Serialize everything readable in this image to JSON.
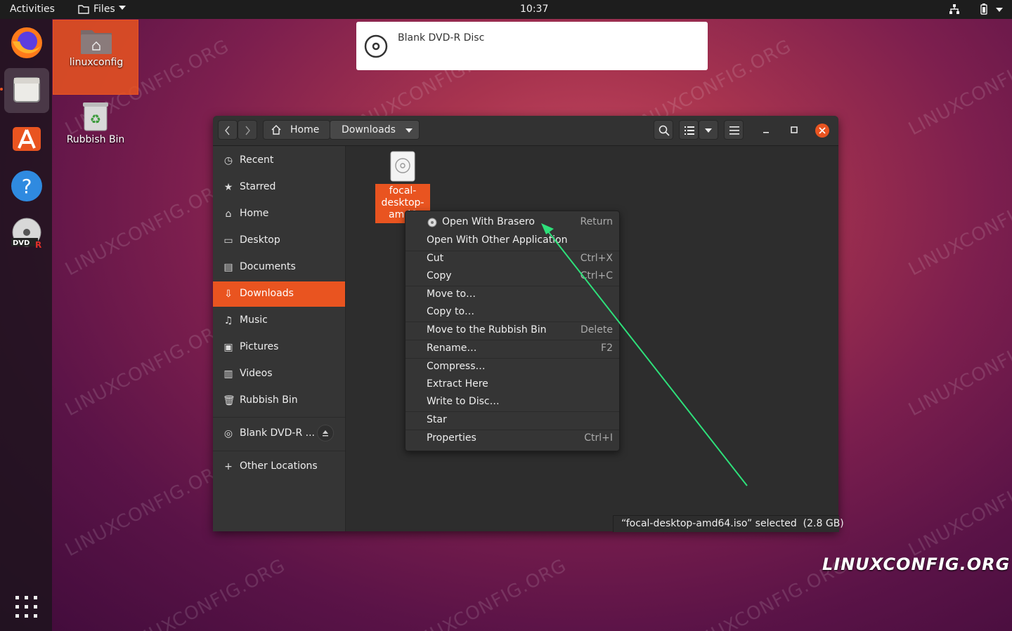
{
  "topbar": {
    "activities": "Activities",
    "app_menu": "Files",
    "clock": "10:37"
  },
  "desktop": {
    "home_folder": "linuxconfig",
    "trash": "Rubbish Bin"
  },
  "notification": {
    "text": "Blank DVD-R Disc"
  },
  "window": {
    "path_home": "Home",
    "path_current": "Downloads",
    "sidebar": [
      {
        "label": "Recent",
        "icon": "clock-icon"
      },
      {
        "label": "Starred",
        "icon": "star-icon"
      },
      {
        "label": "Home",
        "icon": "home-icon"
      },
      {
        "label": "Desktop",
        "icon": "desktop-icon"
      },
      {
        "label": "Documents",
        "icon": "document-icon"
      },
      {
        "label": "Downloads",
        "icon": "download-icon",
        "active": true
      },
      {
        "label": "Music",
        "icon": "music-icon"
      },
      {
        "label": "Pictures",
        "icon": "picture-icon"
      },
      {
        "label": "Videos",
        "icon": "video-icon"
      },
      {
        "label": "Rubbish Bin",
        "icon": "trash-icon"
      }
    ],
    "drive": "Blank DVD-R ...",
    "other_locations": "Other Locations",
    "file": {
      "name_lines": [
        "focal-",
        "desktop-",
        "amd6"
      ]
    },
    "status": "“focal-desktop-amd64.iso” selected  (2.8 GB)"
  },
  "context_menu": [
    {
      "label": "Open With Brasero",
      "shortcut": "Return"
    },
    {
      "label": "Open With Other Application",
      "shortcut": ""
    },
    {
      "label": "Cut",
      "shortcut": "Ctrl+X"
    },
    {
      "label": "Copy",
      "shortcut": "Ctrl+C"
    },
    {
      "label": "Move to…",
      "shortcut": ""
    },
    {
      "label": "Copy to…",
      "shortcut": ""
    },
    {
      "label": "Move to the Rubbish Bin",
      "shortcut": "Delete"
    },
    {
      "label": "Rename…",
      "shortcut": "F2"
    },
    {
      "label": "Compress…",
      "shortcut": ""
    },
    {
      "label": "Extract Here",
      "shortcut": ""
    },
    {
      "label": "Write to Disc…",
      "shortcut": ""
    },
    {
      "label": "Star",
      "shortcut": ""
    },
    {
      "label": "Properties",
      "shortcut": "Ctrl+I"
    }
  ],
  "watermark": "LINUXCONFIG.ORG",
  "logo": "LINUXCONFIG.ORG",
  "colors": {
    "accent": "#e95420",
    "arrow": "#2ecc71"
  }
}
